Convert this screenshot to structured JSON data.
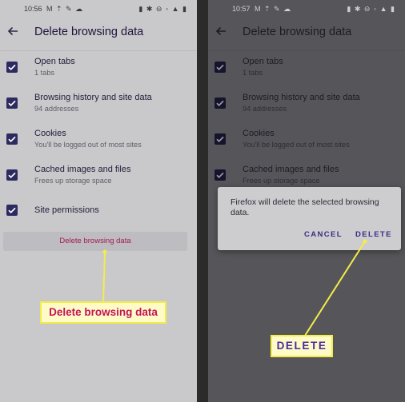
{
  "left": {
    "status": {
      "time": "10:56",
      "icons_left": "M ⇡ ✎ ☁",
      "icons_right": "▮ ✱ ⊖ ◦ ▲ ▮"
    },
    "title": "Delete browsing data",
    "items": [
      {
        "label": "Open tabs",
        "sublabel": "1 tabs",
        "checked": true
      },
      {
        "label": "Browsing history and site data",
        "sublabel": "94 addresses",
        "checked": true
      },
      {
        "label": "Cookies",
        "sublabel": "You'll be logged out of most sites",
        "checked": true
      },
      {
        "label": "Cached images and files",
        "sublabel": "Frees up storage space",
        "checked": true
      },
      {
        "label": "Site permissions",
        "sublabel": "",
        "checked": true
      }
    ],
    "delete_button": "Delete browsing data",
    "callout": "Delete browsing data"
  },
  "right": {
    "status": {
      "time": "10:57",
      "icons_left": "M ⇡ ✎ ☁",
      "icons_right": "▮ ✱ ⊖ ◦ ▲ ▮"
    },
    "title": "Delete browsing data",
    "items": [
      {
        "label": "Open tabs",
        "sublabel": "1 tabs",
        "checked": true
      },
      {
        "label": "Browsing history and site data",
        "sublabel": "94 addresses",
        "checked": true
      },
      {
        "label": "Cookies",
        "sublabel": "You'll be logged out of most sites",
        "checked": true
      },
      {
        "label": "Cached images and files",
        "sublabel": "Frees up storage space",
        "checked": true
      }
    ],
    "dialog": {
      "message": "Firefox will delete the selected browsing data.",
      "cancel": "CANCEL",
      "confirm": "DELETE"
    },
    "callout": "DELETE"
  },
  "colors": {
    "accent_pink": "#c4145a",
    "accent_purple": "#3c2a85",
    "callout_bg": "#fffbc7",
    "callout_border": "#f2ec4c"
  }
}
